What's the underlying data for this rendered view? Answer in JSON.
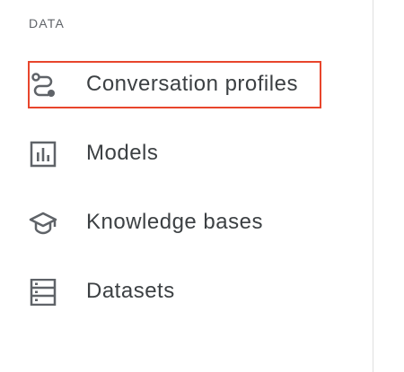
{
  "section": {
    "label": "DATA"
  },
  "nav": {
    "items": [
      {
        "label": "Conversation profiles",
        "icon": "route-icon",
        "selected": true
      },
      {
        "label": "Models",
        "icon": "bar-chart-icon",
        "selected": false
      },
      {
        "label": "Knowledge bases",
        "icon": "school-icon",
        "selected": false
      },
      {
        "label": "Datasets",
        "icon": "dataset-list-icon",
        "selected": false
      }
    ]
  },
  "colors": {
    "text": "#3c4043",
    "icon": "#5f6368",
    "highlight_border": "#e8452c",
    "divider": "#e0e0e0"
  }
}
